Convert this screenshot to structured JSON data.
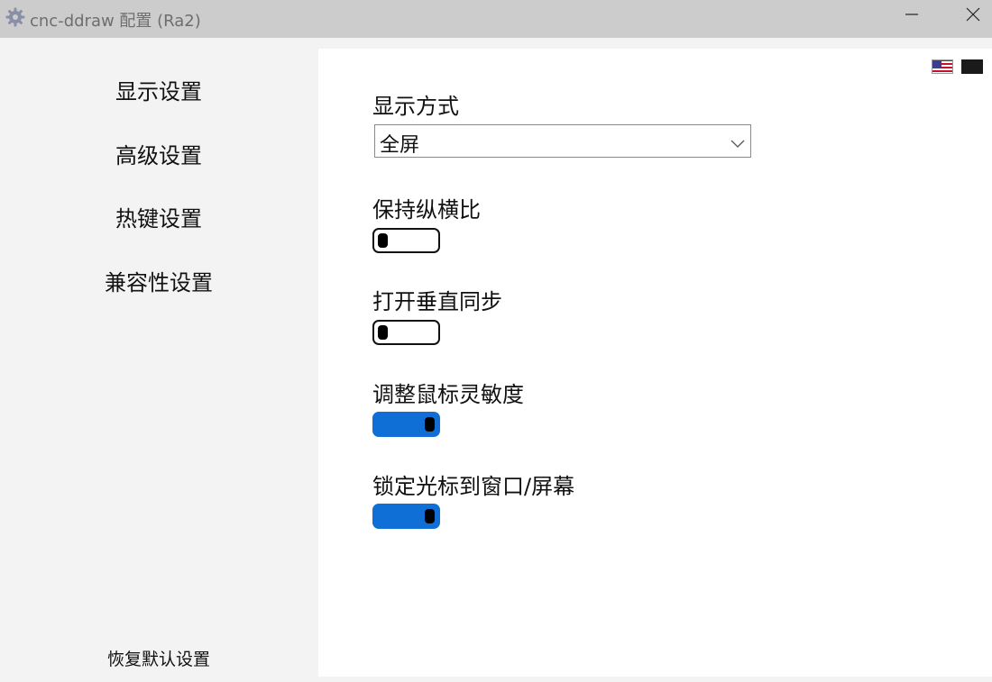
{
  "window": {
    "title": "cnc-ddraw 配置 (Ra2)",
    "icon": "gear-icon"
  },
  "titlebar_buttons": {
    "minimize_icon": "minimize-icon",
    "close_icon": "close-icon"
  },
  "sidebar": {
    "items": [
      {
        "label": "显示设置"
      },
      {
        "label": "高级设置"
      },
      {
        "label": "热键设置"
      },
      {
        "label": "兼容性设置"
      }
    ],
    "reset_label": "恢复默认设置"
  },
  "content": {
    "languages": [
      {
        "icon": "us-flag-icon"
      },
      {
        "icon": "cn-flag-icon"
      }
    ],
    "display_mode": {
      "label": "显示方式",
      "value": "全屏"
    },
    "toggles": [
      {
        "label": "保持纵横比",
        "on": false
      },
      {
        "label": "打开垂直同步",
        "on": false
      },
      {
        "label": "调整鼠标灵敏度",
        "on": true
      },
      {
        "label": "锁定光标到窗口/屏幕",
        "on": true
      }
    ]
  },
  "colors": {
    "toggle_on": "#0f6fd6",
    "titlebar": "#cccccc",
    "sidebar": "#f3f3f3",
    "content": "#ffffff"
  }
}
